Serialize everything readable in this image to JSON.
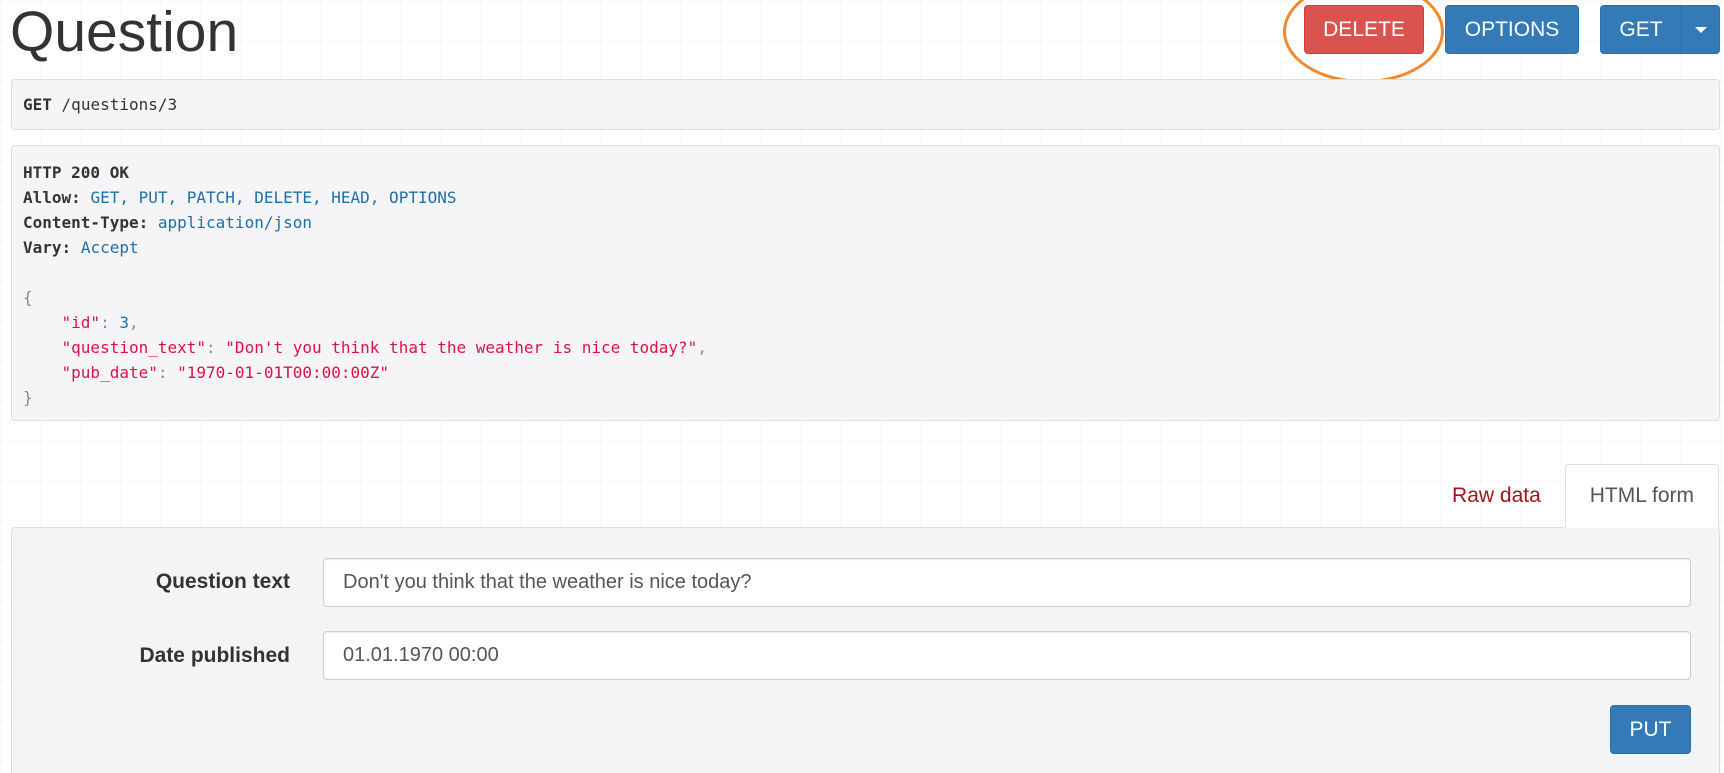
{
  "page": {
    "title": "Question"
  },
  "toolbar": {
    "delete_label": "DELETE",
    "options_label": "OPTIONS",
    "get_label": "GET",
    "highlight_color": "#f0892b"
  },
  "request": {
    "method": "GET",
    "path": "/questions/3"
  },
  "response": {
    "status": "HTTP 200 OK",
    "allow_key": "Allow:",
    "allow_value": "GET, PUT, PATCH, DELETE, HEAD, OPTIONS",
    "content_type_key": "Content-Type:",
    "content_type_value": "application/json",
    "vary_key": "Vary:",
    "vary_value": "Accept",
    "body": {
      "open": "{",
      "close": "}",
      "fields": [
        {
          "key": "\"id\"",
          "value": "3",
          "type": "number",
          "trailing": ","
        },
        {
          "key": "\"question_text\"",
          "value": "\"Don't you think that the weather is nice today?\"",
          "type": "string",
          "trailing": ","
        },
        {
          "key": "\"pub_date\"",
          "value": "\"1970-01-01T00:00:00Z\"",
          "type": "string",
          "trailing": ""
        }
      ]
    }
  },
  "tabs": [
    {
      "label": "Raw data",
      "active": false
    },
    {
      "label": "HTML form",
      "active": true
    }
  ],
  "form": {
    "question_label": "Question text",
    "question_value": "Don't you think that the weather is nice today?",
    "date_label": "Date published",
    "date_value": "01.01.1970 00:00",
    "put_label": "PUT"
  },
  "colors": {
    "danger": "#d9534f",
    "primary": "#337ab7",
    "raw_tab_text": "#a0151a",
    "json_string": "#dd1144",
    "json_literal": "#1f6fa8"
  }
}
